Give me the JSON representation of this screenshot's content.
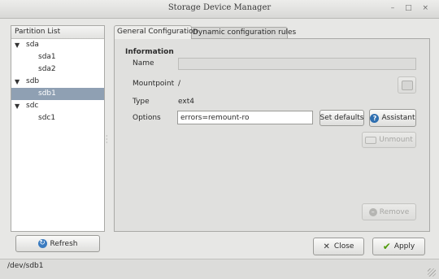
{
  "window": {
    "title": "Storage Device Manager",
    "controls": "– □ ×"
  },
  "partition_list": {
    "header": "Partition List",
    "devices": [
      {
        "label": "sda",
        "children": [
          "sda1",
          "sda2"
        ]
      },
      {
        "label": "sdb",
        "children": [
          "sdb1"
        ]
      },
      {
        "label": "sdc",
        "children": [
          "sdc1"
        ]
      }
    ],
    "selected": "sdb1"
  },
  "tabs": [
    {
      "label": "General Configuration",
      "active": true
    },
    {
      "label": "Dynamic configuration rules",
      "active": false
    }
  ],
  "information": {
    "section_title": "Information",
    "name_label": "Name",
    "name_value": "",
    "mountpoint_label": "Mountpoint",
    "mountpoint_value": "/",
    "type_label": "Type",
    "type_value": "ext4",
    "options_label": "Options",
    "options_value": "errors=remount-ro"
  },
  "buttons": {
    "set_defaults": "Set defaults",
    "assistant": "Assistant",
    "unmount": "Unmount",
    "remove": "Remove",
    "refresh": "Refresh",
    "close": "Close",
    "apply": "Apply"
  },
  "status_bar": {
    "text": "/dev/sdb1"
  },
  "icons": {
    "expand": "triangle-down",
    "help": "help-icon",
    "refresh": "refresh-icon",
    "close": "close-icon",
    "apply": "checkmark-icon",
    "remove": "remove-icon",
    "unmount": "unmount-icon",
    "mountpoint_browse": "drive-icon"
  },
  "colors": {
    "selection": "#8fa0b3",
    "help_blue": "#2f6fb0",
    "apply_green": "#4e9a06"
  }
}
